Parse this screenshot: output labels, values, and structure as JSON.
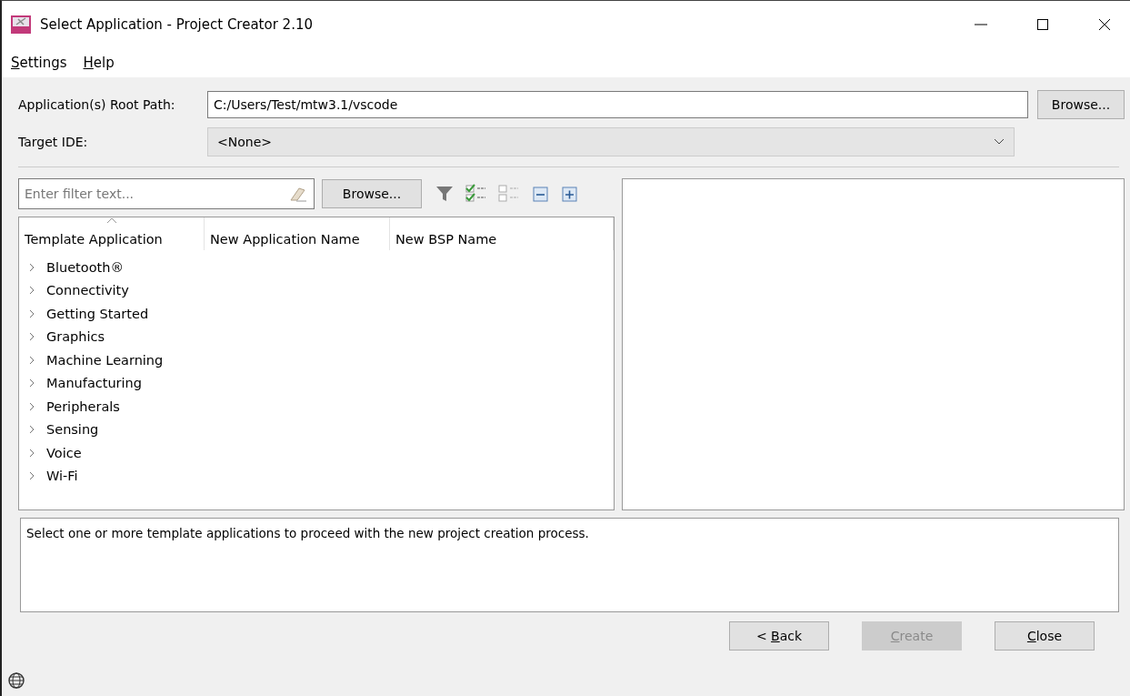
{
  "window": {
    "title": "Select Application - Project Creator 2.10"
  },
  "menu": [
    {
      "key": "S",
      "rest": "ettings"
    },
    {
      "key": "H",
      "rest": "elp"
    }
  ],
  "root_path": {
    "label": "Application(s) Root Path:",
    "value": "C:/Users/Test/mtw3.1/vscode",
    "button": "Browse..."
  },
  "target_ide": {
    "label": "Target IDE:",
    "value": "<None>"
  },
  "filter": {
    "placeholder": "Enter filter text...",
    "button": "Browse..."
  },
  "tree": {
    "columns": [
      {
        "label": "Template Application",
        "sorted": true
      },
      {
        "label": "New Application Name",
        "sorted": false
      },
      {
        "label": "New BSP Name",
        "sorted": false
      }
    ],
    "items": [
      {
        "label": "Bluetooth®",
        "expanded": false
      },
      {
        "label": "Connectivity",
        "expanded": false
      },
      {
        "label": "Getting Started",
        "expanded": false
      },
      {
        "label": "Graphics",
        "expanded": false
      },
      {
        "label": "Machine Learning",
        "expanded": false
      },
      {
        "label": "Manufacturing",
        "expanded": false
      },
      {
        "label": "Peripherals",
        "expanded": false
      },
      {
        "label": "Sensing",
        "expanded": false
      },
      {
        "label": "Voice",
        "expanded": false
      },
      {
        "label": "Wi-Fi",
        "expanded": false
      }
    ]
  },
  "description": "Select one or more template applications to proceed with the new project creation process.",
  "buttons": [
    {
      "prefix": "< ",
      "key": "B",
      "rest": "ack",
      "disabled": false
    },
    {
      "key": "C",
      "rest": "reate",
      "disabled": true
    },
    {
      "key": "C",
      "rest": "lose",
      "disabled": false
    }
  ]
}
